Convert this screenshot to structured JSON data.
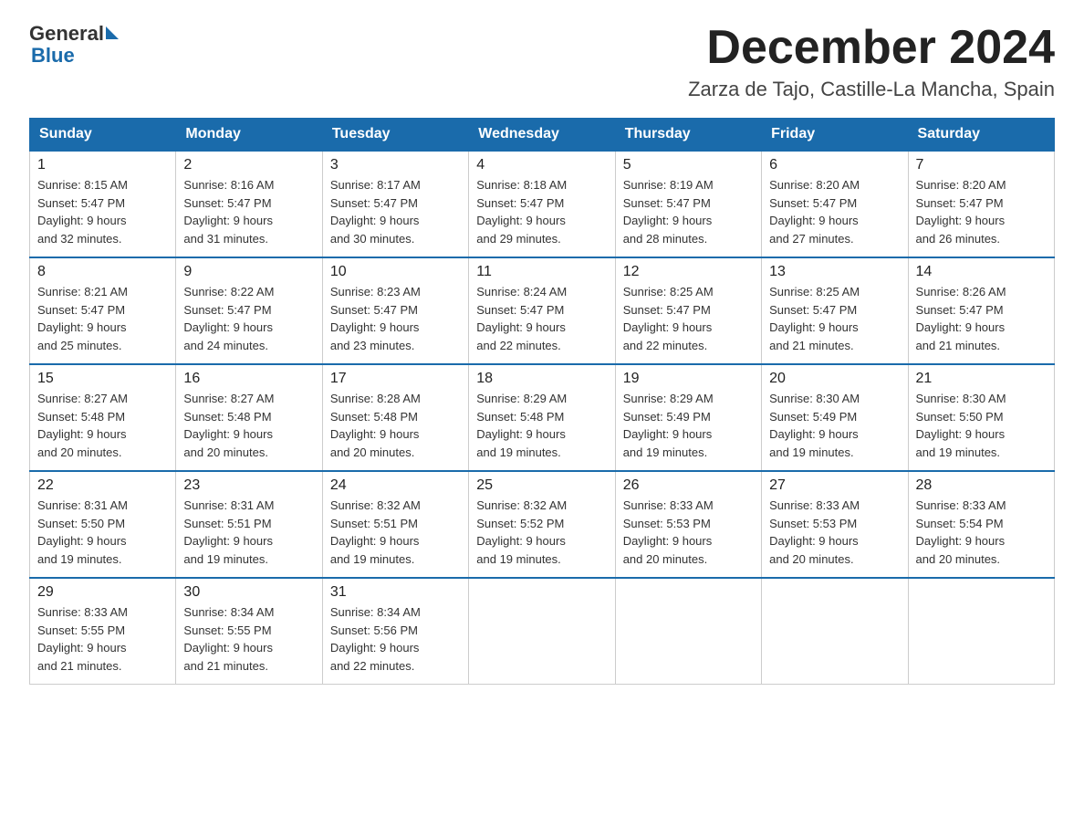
{
  "header": {
    "logo_general": "General",
    "logo_blue": "Blue",
    "month_title": "December 2024",
    "location": "Zarza de Tajo, Castille-La Mancha, Spain"
  },
  "weekdays": [
    "Sunday",
    "Monday",
    "Tuesday",
    "Wednesday",
    "Thursday",
    "Friday",
    "Saturday"
  ],
  "weeks": [
    [
      {
        "day": "1",
        "sunrise": "8:15 AM",
        "sunset": "5:47 PM",
        "daylight": "9 hours and 32 minutes."
      },
      {
        "day": "2",
        "sunrise": "8:16 AM",
        "sunset": "5:47 PM",
        "daylight": "9 hours and 31 minutes."
      },
      {
        "day": "3",
        "sunrise": "8:17 AM",
        "sunset": "5:47 PM",
        "daylight": "9 hours and 30 minutes."
      },
      {
        "day": "4",
        "sunrise": "8:18 AM",
        "sunset": "5:47 PM",
        "daylight": "9 hours and 29 minutes."
      },
      {
        "day": "5",
        "sunrise": "8:19 AM",
        "sunset": "5:47 PM",
        "daylight": "9 hours and 28 minutes."
      },
      {
        "day": "6",
        "sunrise": "8:20 AM",
        "sunset": "5:47 PM",
        "daylight": "9 hours and 27 minutes."
      },
      {
        "day": "7",
        "sunrise": "8:20 AM",
        "sunset": "5:47 PM",
        "daylight": "9 hours and 26 minutes."
      }
    ],
    [
      {
        "day": "8",
        "sunrise": "8:21 AM",
        "sunset": "5:47 PM",
        "daylight": "9 hours and 25 minutes."
      },
      {
        "day": "9",
        "sunrise": "8:22 AM",
        "sunset": "5:47 PM",
        "daylight": "9 hours and 24 minutes."
      },
      {
        "day": "10",
        "sunrise": "8:23 AM",
        "sunset": "5:47 PM",
        "daylight": "9 hours and 23 minutes."
      },
      {
        "day": "11",
        "sunrise": "8:24 AM",
        "sunset": "5:47 PM",
        "daylight": "9 hours and 22 minutes."
      },
      {
        "day": "12",
        "sunrise": "8:25 AM",
        "sunset": "5:47 PM",
        "daylight": "9 hours and 22 minutes."
      },
      {
        "day": "13",
        "sunrise": "8:25 AM",
        "sunset": "5:47 PM",
        "daylight": "9 hours and 21 minutes."
      },
      {
        "day": "14",
        "sunrise": "8:26 AM",
        "sunset": "5:47 PM",
        "daylight": "9 hours and 21 minutes."
      }
    ],
    [
      {
        "day": "15",
        "sunrise": "8:27 AM",
        "sunset": "5:48 PM",
        "daylight": "9 hours and 20 minutes."
      },
      {
        "day": "16",
        "sunrise": "8:27 AM",
        "sunset": "5:48 PM",
        "daylight": "9 hours and 20 minutes."
      },
      {
        "day": "17",
        "sunrise": "8:28 AM",
        "sunset": "5:48 PM",
        "daylight": "9 hours and 20 minutes."
      },
      {
        "day": "18",
        "sunrise": "8:29 AM",
        "sunset": "5:48 PM",
        "daylight": "9 hours and 19 minutes."
      },
      {
        "day": "19",
        "sunrise": "8:29 AM",
        "sunset": "5:49 PM",
        "daylight": "9 hours and 19 minutes."
      },
      {
        "day": "20",
        "sunrise": "8:30 AM",
        "sunset": "5:49 PM",
        "daylight": "9 hours and 19 minutes."
      },
      {
        "day": "21",
        "sunrise": "8:30 AM",
        "sunset": "5:50 PM",
        "daylight": "9 hours and 19 minutes."
      }
    ],
    [
      {
        "day": "22",
        "sunrise": "8:31 AM",
        "sunset": "5:50 PM",
        "daylight": "9 hours and 19 minutes."
      },
      {
        "day": "23",
        "sunrise": "8:31 AM",
        "sunset": "5:51 PM",
        "daylight": "9 hours and 19 minutes."
      },
      {
        "day": "24",
        "sunrise": "8:32 AM",
        "sunset": "5:51 PM",
        "daylight": "9 hours and 19 minutes."
      },
      {
        "day": "25",
        "sunrise": "8:32 AM",
        "sunset": "5:52 PM",
        "daylight": "9 hours and 19 minutes."
      },
      {
        "day": "26",
        "sunrise": "8:33 AM",
        "sunset": "5:53 PM",
        "daylight": "9 hours and 20 minutes."
      },
      {
        "day": "27",
        "sunrise": "8:33 AM",
        "sunset": "5:53 PM",
        "daylight": "9 hours and 20 minutes."
      },
      {
        "day": "28",
        "sunrise": "8:33 AM",
        "sunset": "5:54 PM",
        "daylight": "9 hours and 20 minutes."
      }
    ],
    [
      {
        "day": "29",
        "sunrise": "8:33 AM",
        "sunset": "5:55 PM",
        "daylight": "9 hours and 21 minutes."
      },
      {
        "day": "30",
        "sunrise": "8:34 AM",
        "sunset": "5:55 PM",
        "daylight": "9 hours and 21 minutes."
      },
      {
        "day": "31",
        "sunrise": "8:34 AM",
        "sunset": "5:56 PM",
        "daylight": "9 hours and 22 minutes."
      },
      null,
      null,
      null,
      null
    ]
  ],
  "labels": {
    "sunrise": "Sunrise:",
    "sunset": "Sunset:",
    "daylight": "Daylight:"
  }
}
